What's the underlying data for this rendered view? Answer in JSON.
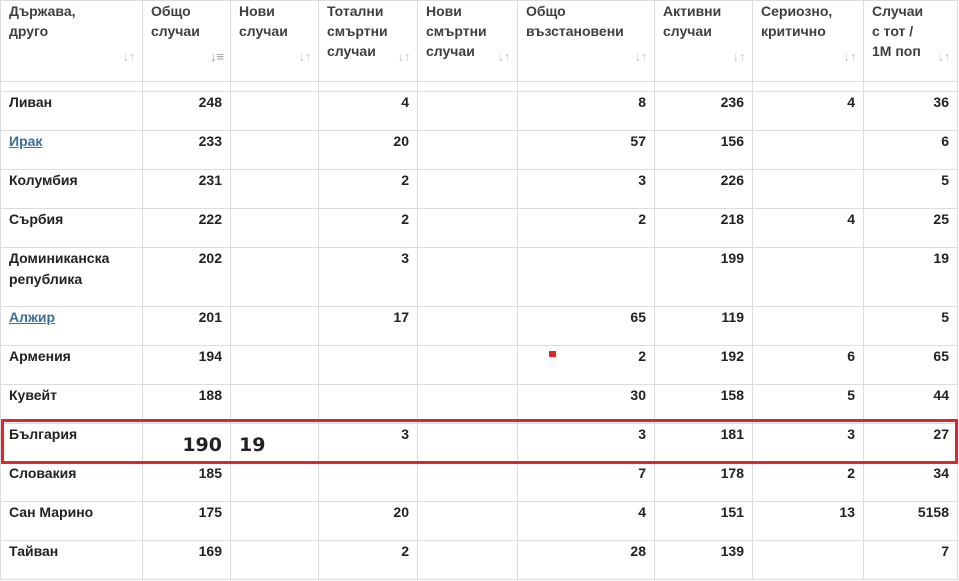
{
  "columns": [
    {
      "label": "Държава,\nдруго",
      "sort": "none"
    },
    {
      "label": "Общо\nслучаи",
      "sort": "desc"
    },
    {
      "label": "Нови\nслучаи",
      "sort": "none"
    },
    {
      "label": "Тотални\nсмъртни\nслучаи",
      "sort": "none"
    },
    {
      "label": "Нови\nсмъртни\nслучаи",
      "sort": "none"
    },
    {
      "label": "Общо\nвъзстановени",
      "sort": "none"
    },
    {
      "label": "Активни\nслучаи",
      "sort": "none"
    },
    {
      "label": "Сериозно,\nкритично",
      "sort": "none"
    },
    {
      "label": "Случаи\nс тот /\n1М поп",
      "sort": "none"
    }
  ],
  "rows": [
    {
      "country": "Ливан",
      "link": false,
      "total": "248",
      "new": "",
      "deaths": "4",
      "new_deaths": "",
      "recovered": "8",
      "active": "236",
      "serious": "4",
      "per_million": "36"
    },
    {
      "country": "Ирак",
      "link": true,
      "total": "233",
      "new": "",
      "deaths": "20",
      "new_deaths": "",
      "recovered": "57",
      "active": "156",
      "serious": "",
      "per_million": "6"
    },
    {
      "country": "Колумбия",
      "link": false,
      "total": "231",
      "new": "",
      "deaths": "2",
      "new_deaths": "",
      "recovered": "3",
      "active": "226",
      "serious": "",
      "per_million": "5"
    },
    {
      "country": "Сърбия",
      "link": false,
      "total": "222",
      "new": "",
      "deaths": "2",
      "new_deaths": "",
      "recovered": "2",
      "active": "218",
      "serious": "4",
      "per_million": "25"
    },
    {
      "country": "Доминиканска\nрепублика",
      "link": false,
      "tall": true,
      "total": "202",
      "new": "",
      "deaths": "3",
      "new_deaths": "",
      "recovered": "",
      "active": "199",
      "serious": "",
      "per_million": "19"
    },
    {
      "country": "Алжир",
      "link": true,
      "total": "201",
      "new": "",
      "deaths": "17",
      "new_deaths": "",
      "recovered": "65",
      "active": "119",
      "serious": "",
      "per_million": "5"
    },
    {
      "country": "Армения",
      "link": false,
      "total": "194",
      "new": "",
      "deaths": "",
      "new_deaths": "",
      "recovered": "2",
      "active": "192",
      "serious": "6",
      "per_million": "65"
    },
    {
      "country": "Кувейт",
      "link": false,
      "total": "188",
      "new": "",
      "deaths": "",
      "new_deaths": "",
      "recovered": "30",
      "active": "158",
      "serious": "5",
      "per_million": "44"
    },
    {
      "country": "България",
      "link": false,
      "highlight": true,
      "total": "190",
      "new": "19",
      "deaths": "3",
      "new_deaths": "",
      "recovered": "3",
      "active": "181",
      "serious": "3",
      "per_million": "27"
    },
    {
      "country": "Словакия",
      "link": false,
      "total": "185",
      "new": "",
      "deaths": "",
      "new_deaths": "",
      "recovered": "7",
      "active": "178",
      "serious": "2",
      "per_million": "34"
    },
    {
      "country": "Сан Марино",
      "link": false,
      "total": "175",
      "new": "",
      "deaths": "20",
      "new_deaths": "",
      "recovered": "4",
      "active": "151",
      "serious": "13",
      "per_million": "5158"
    },
    {
      "country": "Тайван",
      "link": false,
      "total": "169",
      "new": "",
      "deaths": "2",
      "new_deaths": "",
      "recovered": "28",
      "active": "139",
      "serious": "",
      "per_million": "7"
    }
  ],
  "icons": {
    "sort": "sort-arrows-icon",
    "sort_active": "sort-desc-icon"
  },
  "colors": {
    "link": "#3a6f9e",
    "highlight_border": "#e3242b",
    "grid": "#dcdcdc"
  }
}
